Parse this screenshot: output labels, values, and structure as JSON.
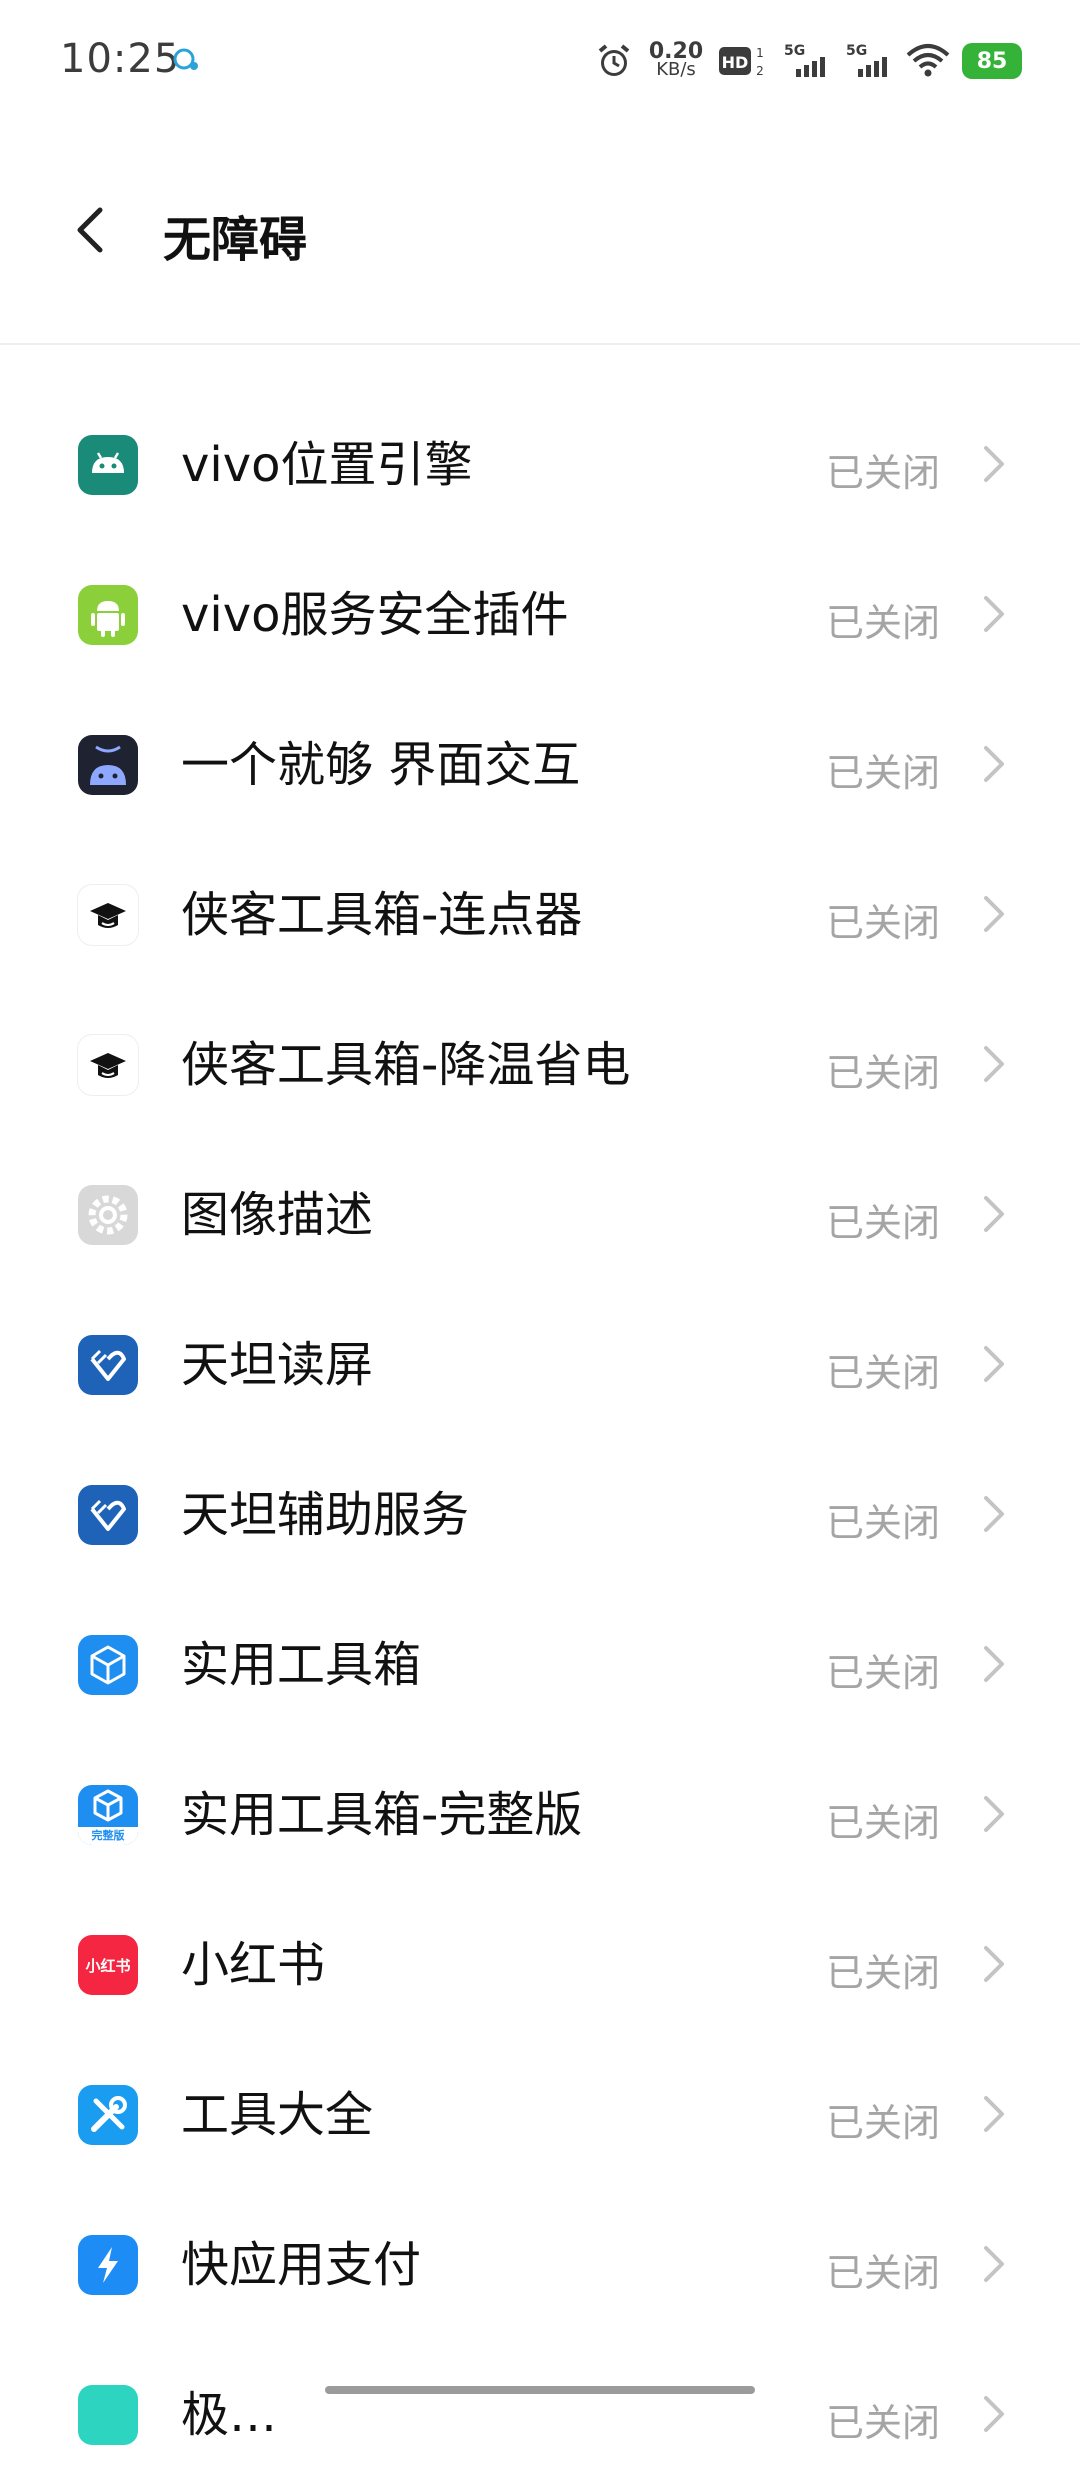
{
  "status_bar": {
    "time": "10:25",
    "net_speed_value": "0.20",
    "net_speed_unit": "KB/s",
    "network_1": "5G",
    "network_2": "5G",
    "hd_label": "HD",
    "battery": "85",
    "battery_color": "#35b238"
  },
  "header": {
    "title": "无障碍",
    "back_icon": "chevron-left-icon"
  },
  "list": [
    {
      "label": "vivo位置引擎",
      "status": "已关闭",
      "icon": "android-icon",
      "color": "#1a8b78"
    },
    {
      "label": "vivo服务安全插件",
      "status": "已关闭",
      "icon": "android-icon",
      "color": "#8bd03a"
    },
    {
      "label": "一个就够 界面交互",
      "status": "已关闭",
      "icon": "android-icon",
      "color": "#1f2230"
    },
    {
      "label": "侠客工具箱-连点器",
      "status": "已关闭",
      "icon": "graduation-cap-icon",
      "color": "#ffffff"
    },
    {
      "label": "侠客工具箱-降温省电",
      "status": "已关闭",
      "icon": "graduation-cap-icon",
      "color": "#ffffff"
    },
    {
      "label": "图像描述",
      "status": "已关闭",
      "icon": "gear-icon",
      "color": "#d8d8d8"
    },
    {
      "label": "天坦读屏",
      "status": "已关闭",
      "icon": "heart-hand-icon",
      "color": "#1e63b8"
    },
    {
      "label": "天坦辅助服务",
      "status": "已关闭",
      "icon": "heart-hand-icon",
      "color": "#1e63b8"
    },
    {
      "label": "实用工具箱",
      "status": "已关闭",
      "icon": "cube-icon",
      "color": "#1e8ef0"
    },
    {
      "label": "实用工具箱-完整版",
      "status": "已关闭",
      "icon": "cube-icon",
      "color": "#1e8ef0",
      "badge": "完整版"
    },
    {
      "label": "小红书",
      "status": "已关闭",
      "icon": "xiaohongshu-icon",
      "color": "#f42641",
      "icon_text": "小红书"
    },
    {
      "label": "工具大全",
      "status": "已关闭",
      "icon": "wrench-icon",
      "color": "#1a9cf0"
    },
    {
      "label": "快应用支付",
      "status": "已关闭",
      "icon": "lightning-icon",
      "color": "#1d8cf5"
    },
    {
      "label": "极…",
      "status": "已关闭",
      "icon": "app-icon",
      "color": "#2dd4c0"
    }
  ]
}
